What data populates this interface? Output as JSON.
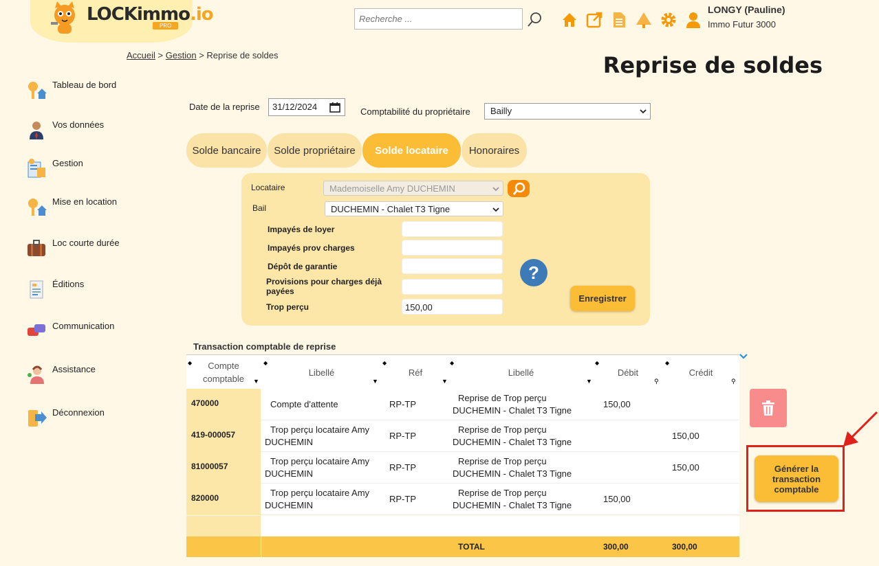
{
  "header": {
    "logo_text": "LOCKimmo",
    "logo_io": ".io",
    "logo_pro": "PRO",
    "search_placeholder": "Recherche ...",
    "user_name": "LONGY (Pauline)",
    "user_company": "Immo Futur 3000"
  },
  "breadcrumb": {
    "home": "Accueil",
    "sep1": ">",
    "gestion": "Gestion",
    "sep2": ">",
    "current": "Reprise de soldes"
  },
  "page_title": "Reprise de soldes",
  "sidebar": {
    "items": [
      {
        "label": "Tableau de bord",
        "icon": "dashboard-icon"
      },
      {
        "label": "Vos données",
        "icon": "person-icon"
      },
      {
        "label": "Gestion",
        "icon": "management-icon"
      },
      {
        "label": "Mise en location",
        "icon": "keys-icon"
      },
      {
        "label": "Loc courte durée",
        "icon": "suitcase-icon"
      },
      {
        "label": "Éditions",
        "icon": "document-icon"
      },
      {
        "label": "Communication",
        "icon": "chat-icon"
      },
      {
        "label": "Assistance",
        "icon": "support-icon"
      },
      {
        "label": "Déconnexion",
        "icon": "logout-icon"
      }
    ]
  },
  "form": {
    "date_label": "Date de la reprise",
    "date_value": "31/12/2024",
    "compta_label": "Comptabilité du propriétaire",
    "compta_value": "Bailly"
  },
  "tabs": [
    {
      "label": "Solde bancaire",
      "active": false
    },
    {
      "label": "Solde propriétaire",
      "active": false
    },
    {
      "label": "Solde locataire",
      "active": true
    },
    {
      "label": "Honoraires",
      "active": false
    }
  ],
  "panel": {
    "locataire_label": "Locataire",
    "locataire_value": "Mademoiselle Amy DUCHEMIN",
    "bail_label": "Bail",
    "bail_value": "DUCHEMIN - Chalet T3 Tigne",
    "fields": [
      {
        "label": "Impayés de loyer",
        "value": ""
      },
      {
        "label": "Impayés prov charges",
        "value": ""
      },
      {
        "label": "Dépôt de garantie",
        "value": ""
      },
      {
        "label": "Provisions pour charges déjà payées",
        "value": ""
      },
      {
        "label": "Trop perçu",
        "value": "150,00"
      }
    ],
    "help_symbol": "?",
    "save_label": "Enregistrer"
  },
  "table": {
    "title": "Transaction comptable de reprise",
    "columns": [
      "Compte comptable",
      "Libellé",
      "Réf",
      "Libellé",
      "Débit",
      "Crédit"
    ],
    "rows": [
      {
        "compte": "470000",
        "libelle": "Compte d'attente",
        "ref": "RP-TP",
        "libelle2": "Reprise de Trop perçu DUCHEMIN - Chalet T3 Tigne",
        "debit": "150,00",
        "credit": ""
      },
      {
        "compte": "419-000057",
        "libelle": "Trop perçu locataire Amy DUCHEMIN",
        "ref": "RP-TP",
        "libelle2": "Reprise de Trop perçu DUCHEMIN - Chalet T3 Tigne",
        "debit": "",
        "credit": "150,00"
      },
      {
        "compte": "81000057",
        "libelle": "Trop perçu locataire Amy DUCHEMIN",
        "ref": "RP-TP",
        "libelle2": "Reprise de Trop perçu DUCHEMIN - Chalet T3 Tigne",
        "debit": "",
        "credit": "150,00"
      },
      {
        "compte": "820000",
        "libelle": "Trop perçu locataire Amy DUCHEMIN",
        "ref": "RP-TP",
        "libelle2": "Reprise de Trop perçu DUCHEMIN - Chalet T3 Tigne",
        "debit": "150,00",
        "credit": ""
      }
    ],
    "total_label": "TOTAL",
    "total_debit": "300,00",
    "total_credit": "300,00"
  },
  "actions": {
    "generate_label": "Générer la transaction comptable"
  },
  "colors": {
    "accent": "#fbbd35",
    "panel": "#fde7a8",
    "background": "#fff8e7",
    "highlight": "#e0201b"
  }
}
